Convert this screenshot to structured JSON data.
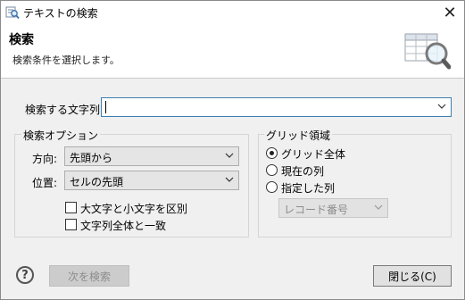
{
  "window": {
    "title": "テキストの検索",
    "close_glyph": "✕"
  },
  "header": {
    "title": "検索",
    "description": "検索条件を選択します。"
  },
  "search": {
    "label": "検索する文字列:",
    "value": ""
  },
  "options": {
    "group_label": "検索オプション",
    "direction": {
      "label": "方向:",
      "value": "先頭から"
    },
    "position": {
      "label": "位置:",
      "value": "セルの先頭"
    },
    "match_case": {
      "label": "大文字と小文字を区別",
      "checked": false
    },
    "match_whole": {
      "label": "文字列全体と一致",
      "checked": false
    }
  },
  "grid": {
    "group_label": "グリッド領域",
    "options": [
      "グリッド全体",
      "現在の列",
      "指定した列"
    ],
    "selected": 0,
    "column_select": {
      "value": "レコード番号"
    }
  },
  "footer": {
    "help_glyph": "?",
    "find_next_label": "次を検索",
    "close_label": "閉じる(C)"
  }
}
